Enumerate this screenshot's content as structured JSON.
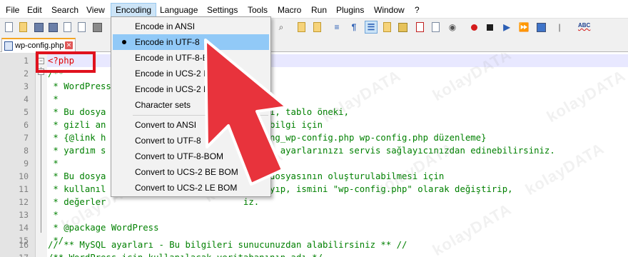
{
  "menubar": {
    "items": [
      "File",
      "Edit",
      "Search",
      "View",
      "Encoding",
      "Language",
      "Settings",
      "Tools",
      "Macro",
      "Run",
      "Plugins",
      "Window",
      "?"
    ]
  },
  "tab": {
    "name": "wp-config.php",
    "close_glyph": "✕"
  },
  "encoding_menu": {
    "items": [
      {
        "label": "Encode in ANSI",
        "selected": false
      },
      {
        "label": "Encode in UTF-8",
        "selected": true
      },
      {
        "label": "Encode in UTF-8-BOM",
        "selected": false
      },
      {
        "label": "Encode in UCS-2 BE BOM",
        "selected": false
      },
      {
        "label": "Encode in UCS-2 LE BOM",
        "selected": false
      },
      {
        "label": "Character sets",
        "selected": false
      },
      {
        "label": "Convert to ANSI",
        "selected": false
      },
      {
        "label": "Convert to UTF-8",
        "selected": false
      },
      {
        "label": "Convert to UTF-8-BOM",
        "selected": false
      },
      {
        "label": "Convert to UCS-2 BE BOM",
        "selected": false
      },
      {
        "label": "Convert to UCS-2 LE BOM",
        "selected": false
      }
    ]
  },
  "editor": {
    "lines": [
      {
        "n": "1",
        "text": "<?php"
      },
      {
        "n": "2",
        "text": "/**"
      },
      {
        "n": "3",
        "text": " * WordPress"
      },
      {
        "n": "4",
        "text": " *"
      },
      {
        "n": "5",
        "text": " * Bu dosya                            ları, tablo öneki,"
      },
      {
        "n": "6",
        "text": " * gizli an                           zla bilgi için"
      },
      {
        "n": "7",
        "text": " * {@link h                           diting_wp-config.php wp-config.php düzenleme}"
      },
      {
        "n": "8",
        "text": " * yardım s                           MySQL ayarlarınızı servis sağlayıcınızdan edinebilirsiniz."
      },
      {
        "n": "9",
        "text": " *"
      },
      {
        "n": "10",
        "text": " * Bu dosya                          .php dosyasının oluşturulabilmesi için"
      },
      {
        "n": "11",
        "text": " * kullanıl                          oyalayıp, ismini \"wp-config.php\" olarak değiştirip,"
      },
      {
        "n": "12",
        "text": " * değerler                          iz."
      },
      {
        "n": "13",
        "text": " *"
      },
      {
        "n": "14",
        "text": " * @package WordPress"
      },
      {
        "n": "15",
        "text": " */"
      },
      {
        "n": "16",
        "text": "// ** MySQL ayarları - Bu bilgileri sunucunuzdan alabilirsiniz ** //"
      },
      {
        "n": "17",
        "text": "/** WordPress için kullanılacak veritabanının adı */"
      }
    ]
  },
  "watermark": {
    "text": "kolayDATA"
  },
  "colors": {
    "accent_red": "#e0121e",
    "menu_selected": "#91c9f7",
    "comment_green": "#008000",
    "php_tag_red": "#e00000",
    "current_line": "#e8e8ff"
  },
  "icons": [
    "new-file-icon",
    "open-file-icon",
    "save-icon",
    "save-all-icon",
    "close-icon",
    "close-all-icon",
    "print-icon",
    "wrap-icon",
    "show-all-chars-icon",
    "indent-guide-icon",
    "doc-map-icon",
    "function-list-icon",
    "folder-workspace-icon",
    "monitoring-icon",
    "record-macro-icon",
    "stop-macro-icon",
    "play-macro-icon",
    "run-macro-multiple-icon",
    "save-macro-icon",
    "spell-check-icon"
  ]
}
